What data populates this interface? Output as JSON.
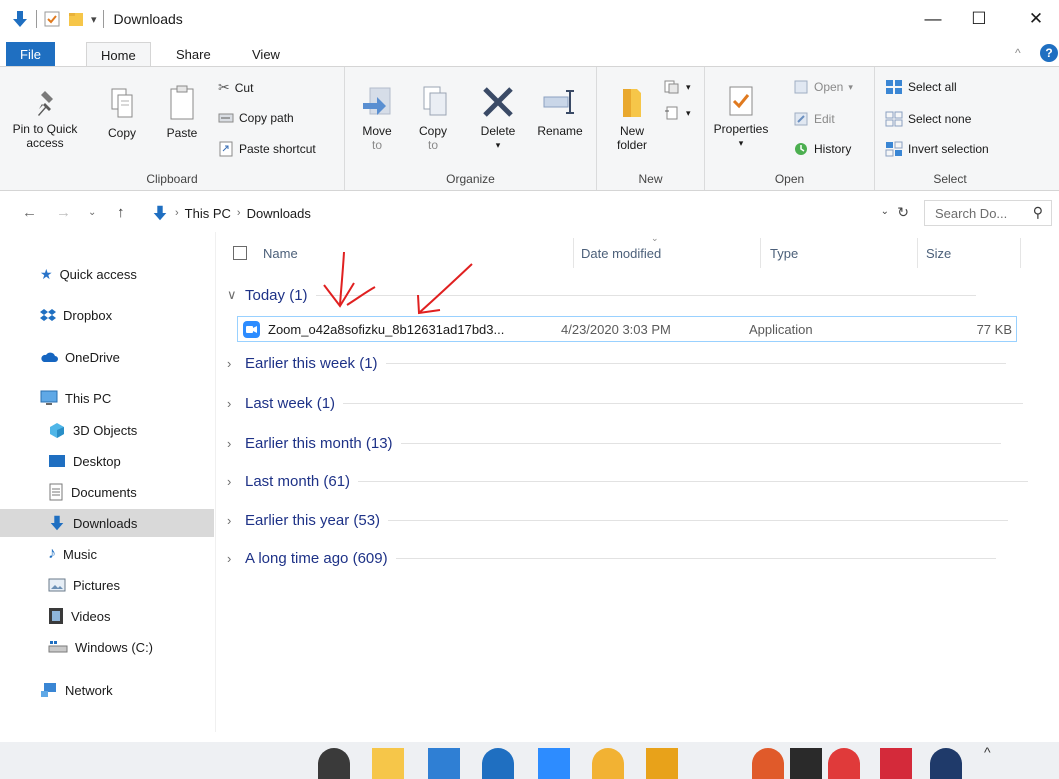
{
  "window": {
    "title": "Downloads",
    "controls": {
      "minimize": "—",
      "maximize": "☐",
      "close": "✕"
    }
  },
  "ribbon_tabs": [
    {
      "label": "File"
    },
    {
      "label": "Home"
    },
    {
      "label": "Share"
    },
    {
      "label": "View"
    }
  ],
  "ribbon": {
    "clipboard": {
      "label": "Clipboard",
      "pin_line1": "Pin to Quick",
      "pin_line2": "access",
      "copy": "Copy",
      "paste": "Paste",
      "cut": "Cut",
      "copy_path": "Copy path",
      "paste_shortcut": "Paste shortcut"
    },
    "organize": {
      "label": "Organize",
      "move_to": "Move",
      "move_to2": "to",
      "copy_to": "Copy",
      "copy_to2": "to",
      "delete": "Delete",
      "rename": "Rename"
    },
    "new": {
      "label": "New",
      "new_folder1": "New",
      "new_folder2": "folder"
    },
    "open": {
      "label": "Open",
      "properties": "Properties",
      "open": "Open",
      "edit": "Edit",
      "history": "History"
    },
    "select": {
      "label": "Select",
      "select_all": "Select all",
      "select_none": "Select none",
      "invert": "Invert selection"
    }
  },
  "address": {
    "path": [
      "This PC",
      "Downloads"
    ],
    "search_placeholder": "Search Do..."
  },
  "nav": [
    {
      "label": "Quick access",
      "icon": "star-icon"
    },
    {
      "label": "Dropbox",
      "icon": "dropbox-icon"
    },
    {
      "label": "OneDrive",
      "icon": "cloud-icon"
    },
    {
      "label": "This PC",
      "icon": "computer-icon"
    },
    {
      "label": "3D Objects",
      "icon": "cube-icon"
    },
    {
      "label": "Desktop",
      "icon": "desktop-icon"
    },
    {
      "label": "Documents",
      "icon": "document-icon"
    },
    {
      "label": "Downloads",
      "icon": "download-icon",
      "selected": true
    },
    {
      "label": "Music",
      "icon": "music-icon"
    },
    {
      "label": "Pictures",
      "icon": "pictures-icon"
    },
    {
      "label": "Videos",
      "icon": "film-icon"
    },
    {
      "label": "Windows (C:)",
      "icon": "drive-icon"
    },
    {
      "label": "Network",
      "icon": "network-icon"
    }
  ],
  "columns": {
    "name": "Name",
    "date": "Date modified",
    "type": "Type",
    "size": "Size"
  },
  "groups": [
    {
      "label": "Today (1)",
      "expanded": true
    },
    {
      "label": "Earlier this week (1)"
    },
    {
      "label": "Last week (1)"
    },
    {
      "label": "Earlier this month (13)"
    },
    {
      "label": "Last month (61)"
    },
    {
      "label": "Earlier this year (53)"
    },
    {
      "label": "A long time ago (609)"
    }
  ],
  "file": {
    "name": "Zoom_o42a8sofizku_8b12631ad17bd3...",
    "date": "4/23/2020 3:03 PM",
    "type": "Application",
    "size": "77 KB"
  },
  "colors": {
    "accent": "#1f6fc1",
    "group_text": "#1e3287",
    "selection_border": "#99d1ff",
    "annotation": "#e02020"
  }
}
